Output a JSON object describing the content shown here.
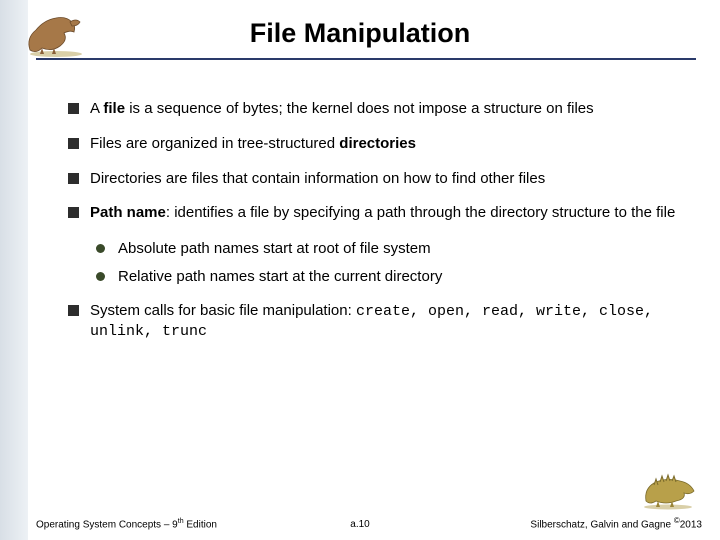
{
  "title": "File Manipulation",
  "bullets": {
    "b1": {
      "pre": "A ",
      "bold": "file",
      "post": " is a sequence of bytes; the kernel does not impose a structure on files"
    },
    "b2": {
      "pre": "Files are organized in tree-structured ",
      "bold": "directories",
      "post": ""
    },
    "b3": {
      "text": "Directories are files that contain information on how to find other files"
    },
    "b4": {
      "bold": "Path name",
      "post": ":  identifies a file by specifying a path through the directory structure to the file"
    },
    "b4a": "Absolute path names start at root of file system",
    "b4b": "Relative path names start at the current directory",
    "b5": {
      "pre": "System calls for basic file manipulation: ",
      "code": "create, open, read, write, close, unlink, trunc"
    }
  },
  "footer": {
    "left_pre": "Operating System Concepts – 9",
    "left_sup": "th",
    "left_post": " Edition",
    "mid": "a.10",
    "right_pre": "Silberschatz, Galvin and Gagne ",
    "right_copy": "©",
    "right_post": "2013"
  }
}
